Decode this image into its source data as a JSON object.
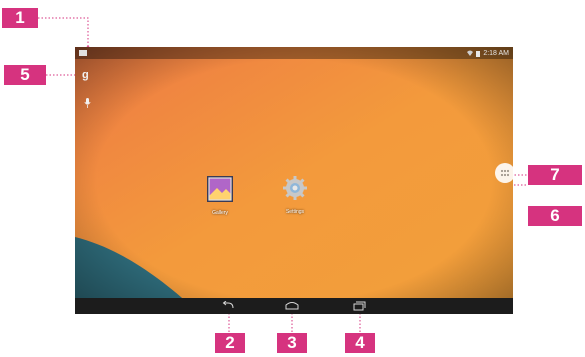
{
  "callouts": {
    "statusbar": "1",
    "back": "2",
    "home": "3",
    "recents": "4",
    "google_search": "5",
    "settings_app": "6",
    "all_apps": "7"
  },
  "statusbar": {
    "time": "2:18 AM"
  },
  "apps": {
    "gallery": {
      "label": "Gallery"
    },
    "settings": {
      "label": "Settings"
    }
  },
  "search": {
    "google_glyph": "g"
  },
  "colors": {
    "callout": "#d6337f",
    "wallpaper_orange": "#f08a3e",
    "wallpaper_teal": "#2e6b7a",
    "navbar": "#1c1c1c"
  },
  "icons": {
    "back": "back-arrow-icon",
    "home": "home-icon",
    "recents": "recents-icon",
    "all_apps": "app-drawer-icon",
    "mic": "microphone-icon"
  }
}
